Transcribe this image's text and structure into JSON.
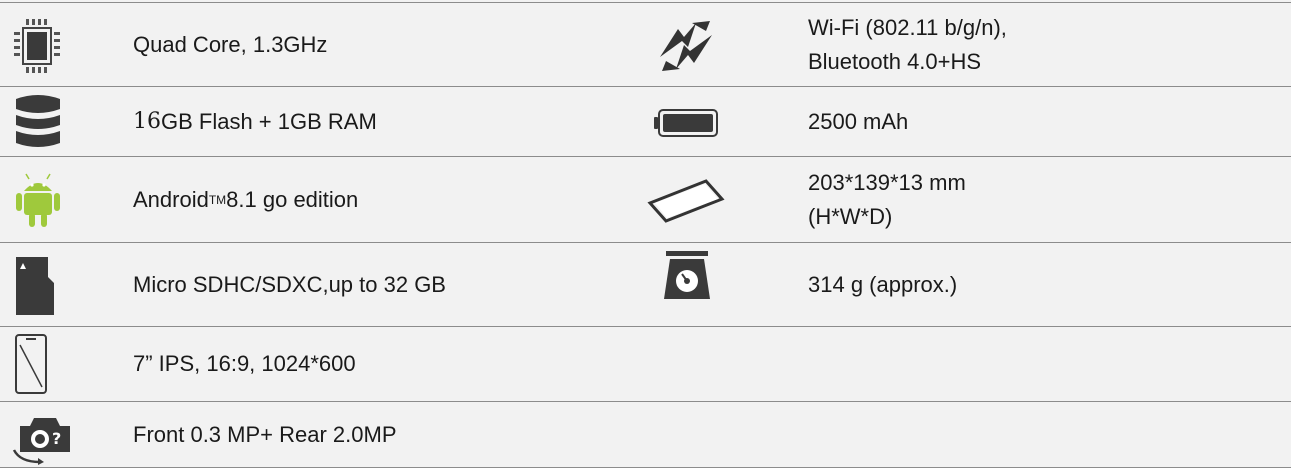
{
  "specs": {
    "cpu": {
      "icon": "cpu-chip-icon",
      "text": "Quad Core, 1.3GHz"
    },
    "connectivity": {
      "icon": "sync-arrows-icon",
      "line1": "Wi-Fi (802.11 b/g/n),",
      "line2": "Bluetooth 4.0+HS"
    },
    "storage": {
      "icon": "database-stack-icon",
      "num": "16",
      "text": " GB Flash + 1GB RAM"
    },
    "battery": {
      "icon": "battery-icon",
      "text": "2500 mAh"
    },
    "os": {
      "icon": "android-icon",
      "pre": "Android",
      "tm": "TM",
      "post": " 8.1 go edition"
    },
    "dimensions": {
      "icon": "tablet-dimensions-icon",
      "line1": "203*139*13 mm",
      "line2": "(H*W*D)"
    },
    "card": {
      "icon": "sd-card-icon",
      "text": "Micro SDHC/SDXC,up to 32 GB"
    },
    "weight": {
      "icon": "weighing-scale-icon",
      "text": "314 g (approx.)"
    },
    "display": {
      "icon": "phone-screen-icon",
      "text": "7” IPS, 16:9, 1024*600"
    },
    "camera": {
      "icon": "camera-rotate-icon",
      "text": "Front 0.3 MP+ Rear 2.0MP"
    }
  },
  "colors": {
    "row_bg": "#f2f2f2",
    "border": "#8c8c8c",
    "android_green": "#9fc93c",
    "icon_dark": "#3a3a3a"
  }
}
